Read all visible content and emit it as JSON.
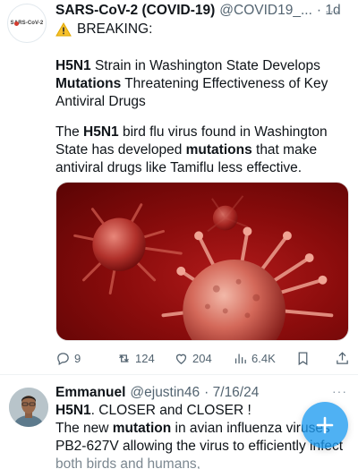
{
  "tweet1": {
    "avatar_text": "SARS-CoV-2",
    "name": "SARS-CoV-2 (COVID-19)",
    "handle": "@COVID19_...",
    "time": "· 1d",
    "more": "···",
    "breaking": "BREAKING:",
    "headline_bold1": "H5N1",
    "headline_rest1": " Strain in Washington State Develops",
    "headline_bold2": "Mutations",
    "headline_rest2": " Threatening Effectiveness of Key Antiviral Drugs",
    "p2_a": "The ",
    "p2_b": "H5N1",
    "p2_c": " bird flu virus found in Washington State has developed ",
    "p2_d": "mutations",
    "p2_e": " that make antiviral drugs like Tamiflu less effective.",
    "replies": "9",
    "reposts": "124",
    "likes": "204",
    "views": "6.4K",
    "colors": {
      "media_bg": "#8a0c0c",
      "icon_gray": "#536471"
    }
  },
  "tweet2": {
    "name": "Emmanuel",
    "handle": "@ejustin46",
    "date": "· 7/16/24",
    "more": "···",
    "line1_bold": "H5N1",
    "line1_rest": ". CLOSER and CLOSER !",
    "body_a": "The new ",
    "body_b": "mutation",
    "body_c": " in avian influenza viruses PB2-627V allowing the virus to efficiently infect ",
    "body_d": "both birds and humans,"
  },
  "fab": {
    "color": "#1d9bf0",
    "icon": "plus-icon"
  }
}
